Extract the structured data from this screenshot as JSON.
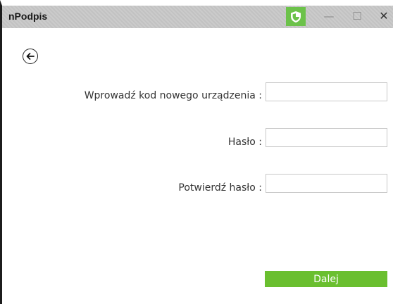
{
  "window": {
    "title": "nPodpis",
    "minimize_glyph": "—",
    "maximize_glyph": "☐",
    "close_glyph": "✕"
  },
  "icons": {
    "shield": "shield-icon",
    "back": "arrow-left-icon"
  },
  "form": {
    "device_code_label": "Wprowadź kod nowego urządzenia :",
    "device_code_value": "",
    "password_label": "Hasło :",
    "password_value": "",
    "confirm_password_label": "Potwierdź hasło :",
    "confirm_password_value": "",
    "submit_label": "Dalej"
  },
  "colors": {
    "accent": "#6abf2f",
    "shield": "#6cc24a",
    "titlebar": "#c8c8c8"
  }
}
